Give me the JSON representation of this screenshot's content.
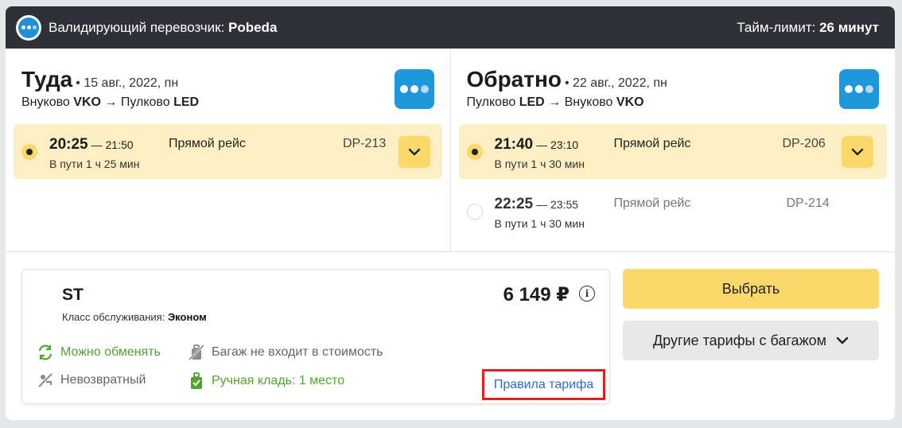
{
  "topbar": {
    "carrier_label": "Валидирующий перевозчик:",
    "carrier_name": "Pobeda",
    "time_limit_label": "Тайм-лимит:",
    "time_limit_value": "26 минут"
  },
  "outbound": {
    "title": "Туда",
    "date": "15 авг., 2022, пн",
    "from_city": "Внуково",
    "from_code": "VKO",
    "to_city": "Пулково",
    "to_code": "LED",
    "flights": [
      {
        "depart": "20:25",
        "arrive": "21:50",
        "duration": "В пути 1 ч 25 мин",
        "type": "Прямой рейс",
        "number": "DP-213",
        "selected": true
      }
    ]
  },
  "return": {
    "title": "Обратно",
    "date": "22 авг., 2022, пн",
    "from_city": "Пулково",
    "from_code": "LED",
    "to_city": "Внуково",
    "to_code": "VKO",
    "flights": [
      {
        "depart": "21:40",
        "arrive": "23:10",
        "duration": "В пути 1 ч 30 мин",
        "type": "Прямой рейс",
        "number": "DP-206",
        "selected": true
      },
      {
        "depart": "22:25",
        "arrive": "23:55",
        "duration": "В пути 1 ч 30 мин",
        "type": "Прямой рейс",
        "number": "DP-214",
        "selected": false
      }
    ]
  },
  "tariff": {
    "name": "ST",
    "class_label": "Класс обслуживания:",
    "class_value": "Эконом",
    "price": "6 149 ₽",
    "features": {
      "exchange": "Можно обменять",
      "baggage": "Багаж не входит в стоимость",
      "refund": "Невозвратный",
      "hand_luggage": "Ручная кладь: 1 место"
    },
    "rules_link": "Правила тарифа"
  },
  "actions": {
    "select": "Выбрать",
    "other_tariffs": "Другие тарифы с багажом"
  },
  "colors": {
    "accent_yellow": "#fbd86a",
    "selected_bg": "#fdeec3",
    "green": "#52a32f",
    "link_blue": "#2e6ad6",
    "highlight_red": "#e0201f",
    "airline_blue": "#1f97dc"
  }
}
